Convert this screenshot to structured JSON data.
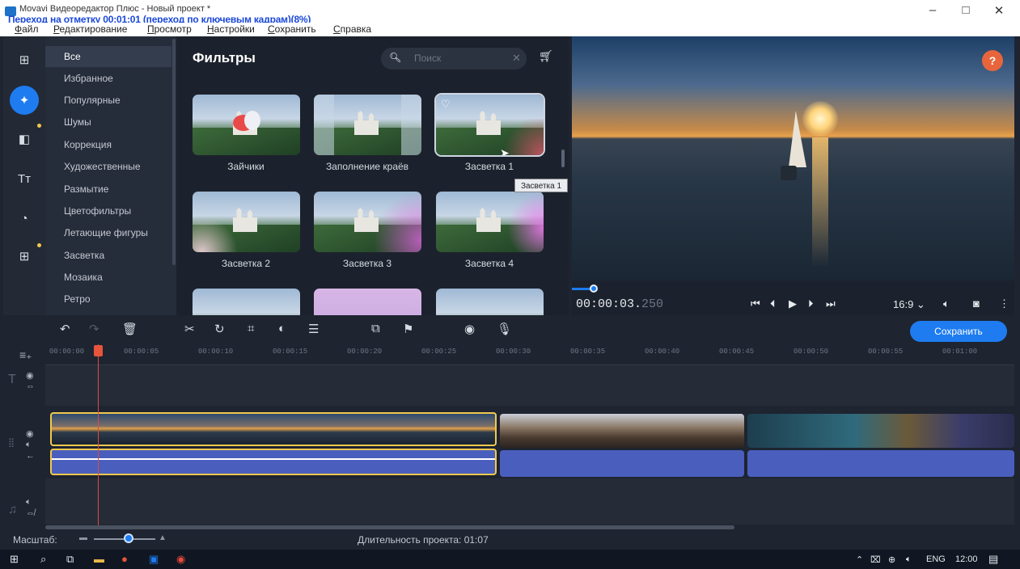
{
  "window": {
    "title": "Movavi Видеоредактор Плюс - Новый проект *",
    "overlay_status": "Переход на отметку 00:01:01 (переход по ключевым кадрам)(8%)",
    "minimize": "–",
    "maximize": "□",
    "close": "✕"
  },
  "menu": [
    "Файл",
    "Редактирование",
    "Просмотр",
    "Настройки",
    "Сохранить",
    "Справка"
  ],
  "categories": [
    "Все",
    "Избранное",
    "Популярные",
    "Шумы",
    "Коррекция",
    "Художественные",
    "Размытие",
    "Цветофильтры",
    "Летающие фигуры",
    "Засветка",
    "Мозаика",
    "Ретро"
  ],
  "filters_panel": {
    "title": "Фильтры",
    "search_placeholder": "Поиск",
    "items": [
      "Зайчики",
      "Заполнение краёв",
      "Засветка 1",
      "Засветка 2",
      "Засветка 3",
      "Засветка 4"
    ],
    "tooltip": "Засветка 1",
    "help": "?"
  },
  "player": {
    "timecode_main": "00:00:03.",
    "timecode_ms": "250",
    "aspect": "16:9 ⌄",
    "progress_fraction": 0.05
  },
  "toolbar": {
    "save_label": "Сохранить"
  },
  "ruler_ticks": [
    "00:00:00",
    "00:00:05",
    "00:00:10",
    "00:00:15",
    "00:00:20",
    "00:00:25",
    "00:00:30",
    "00:00:35",
    "00:00:40",
    "00:00:45",
    "00:00:50",
    "00:00:55",
    "00:01:00"
  ],
  "bottom": {
    "zoom_label": "Масштаб:",
    "duration": "Длительность проекта: 01:07"
  },
  "taskbar": {
    "lang": "ENG",
    "time": "12:00"
  },
  "colors": {
    "accent": "#1e7cf0",
    "playhead": "#e04a3a",
    "audio_track": "#4a5fbd",
    "selected_clip": "#f2c94c"
  }
}
